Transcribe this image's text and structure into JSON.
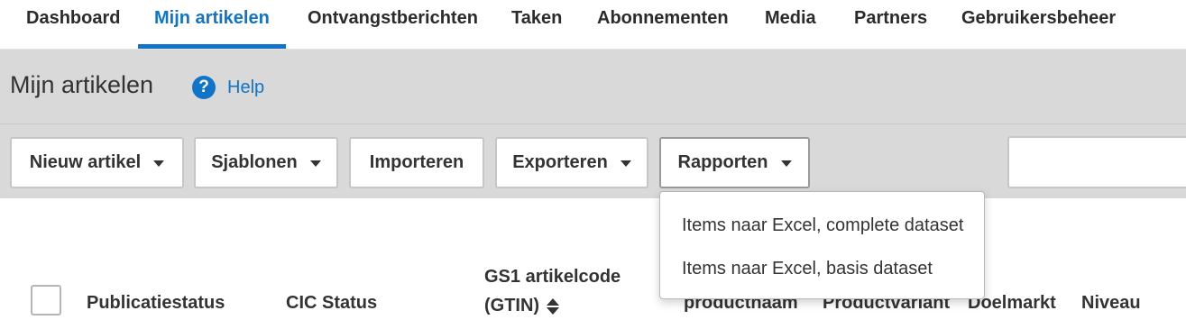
{
  "nav": {
    "items": [
      {
        "label": "Dashboard",
        "active": false
      },
      {
        "label": "Mijn artikelen",
        "active": true
      },
      {
        "label": "Ontvangstberichten",
        "active": false
      },
      {
        "label": "Taken",
        "active": false
      },
      {
        "label": "Abonnementen",
        "active": false
      },
      {
        "label": "Media",
        "active": false
      },
      {
        "label": "Partners",
        "active": false
      },
      {
        "label": "Gebruikersbeheer",
        "active": false
      }
    ]
  },
  "header": {
    "title": "Mijn artikelen",
    "help_icon": "question-circle-icon",
    "help_label": "Help"
  },
  "toolbar": {
    "new_item_label": "Nieuw artikel",
    "templates_label": "Sjablonen",
    "import_label": "Importeren",
    "export_label": "Exporteren",
    "reports_label": "Rapporten",
    "search_value": ""
  },
  "reports_menu": {
    "items": [
      "Items naar Excel, complete dataset",
      "Items naar Excel, basis dataset"
    ]
  },
  "table": {
    "columns": {
      "publication_status": "Publicatiestatus",
      "cic_status": "CIC Status",
      "gtin_line1": "GS1 artikelcode",
      "gtin_line2": "(GTIN)",
      "product_name": "productnaam",
      "product_variant": "Productvariant",
      "target_market": "Doelmarkt",
      "level": "Niveau"
    }
  },
  "colors": {
    "accent": "#1075c9",
    "header_band": "#d9d9d9",
    "text": "#333333"
  }
}
